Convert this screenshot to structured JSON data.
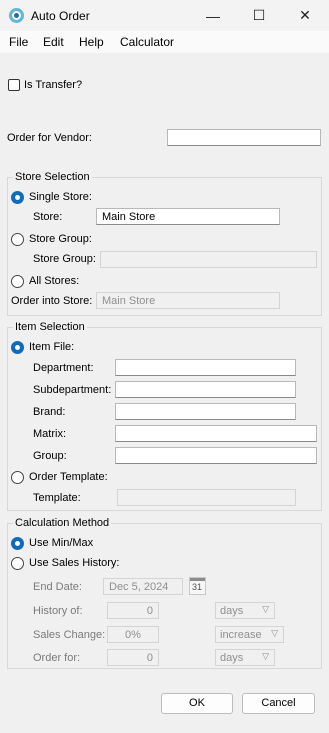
{
  "window": {
    "title": "Auto Order",
    "minimize_glyph": "—",
    "maximize_glyph": "☐",
    "close_glyph": "✕"
  },
  "menu": [
    "File",
    "Edit",
    "Help",
    "Calculator"
  ],
  "transfer": {
    "label": "Is Transfer?",
    "checked": false
  },
  "vendor": {
    "label": "Order for Vendor:",
    "value": ""
  },
  "store_selection": {
    "legend": "Store Selection",
    "single_store": "Single Store:",
    "store_label": "Store:",
    "store_value": "Main Store",
    "store_group": "Store Group:",
    "store_group_label": "Store Group:",
    "store_group_value": "",
    "all_stores": "All Stores:",
    "order_into_label": "Order into Store:",
    "order_into_value": "Main Store",
    "selected": "single_store"
  },
  "item_selection": {
    "legend": "Item Selection",
    "item_file": "Item File:",
    "fields": [
      {
        "label": "Department:",
        "value": ""
      },
      {
        "label": "Subdepartment:",
        "value": ""
      },
      {
        "label": "Brand:",
        "value": ""
      },
      {
        "label": "Matrix:",
        "value": ""
      },
      {
        "label": "Group:",
        "value": ""
      }
    ],
    "order_template": "Order Template:",
    "template_label": "Template:",
    "template_value": "",
    "selected": "item_file"
  },
  "calculation": {
    "legend": "Calculation Method",
    "use_minmax": "Use Min/Max",
    "use_sales_history": "Use Sales History:",
    "end_date_label": "End Date:",
    "end_date_value": "Dec 5, 2024",
    "calendar_day": "31",
    "history_label": "History of:",
    "history_value": "0",
    "history_unit": "days",
    "sales_change_label": "Sales Change:",
    "sales_change_value": "0%",
    "sales_change_direction": "increase",
    "order_for_label": "Order for:",
    "order_for_value": "0",
    "order_for_unit": "days",
    "selected": "use_minmax"
  },
  "buttons": {
    "ok": "OK",
    "cancel": "Cancel"
  }
}
